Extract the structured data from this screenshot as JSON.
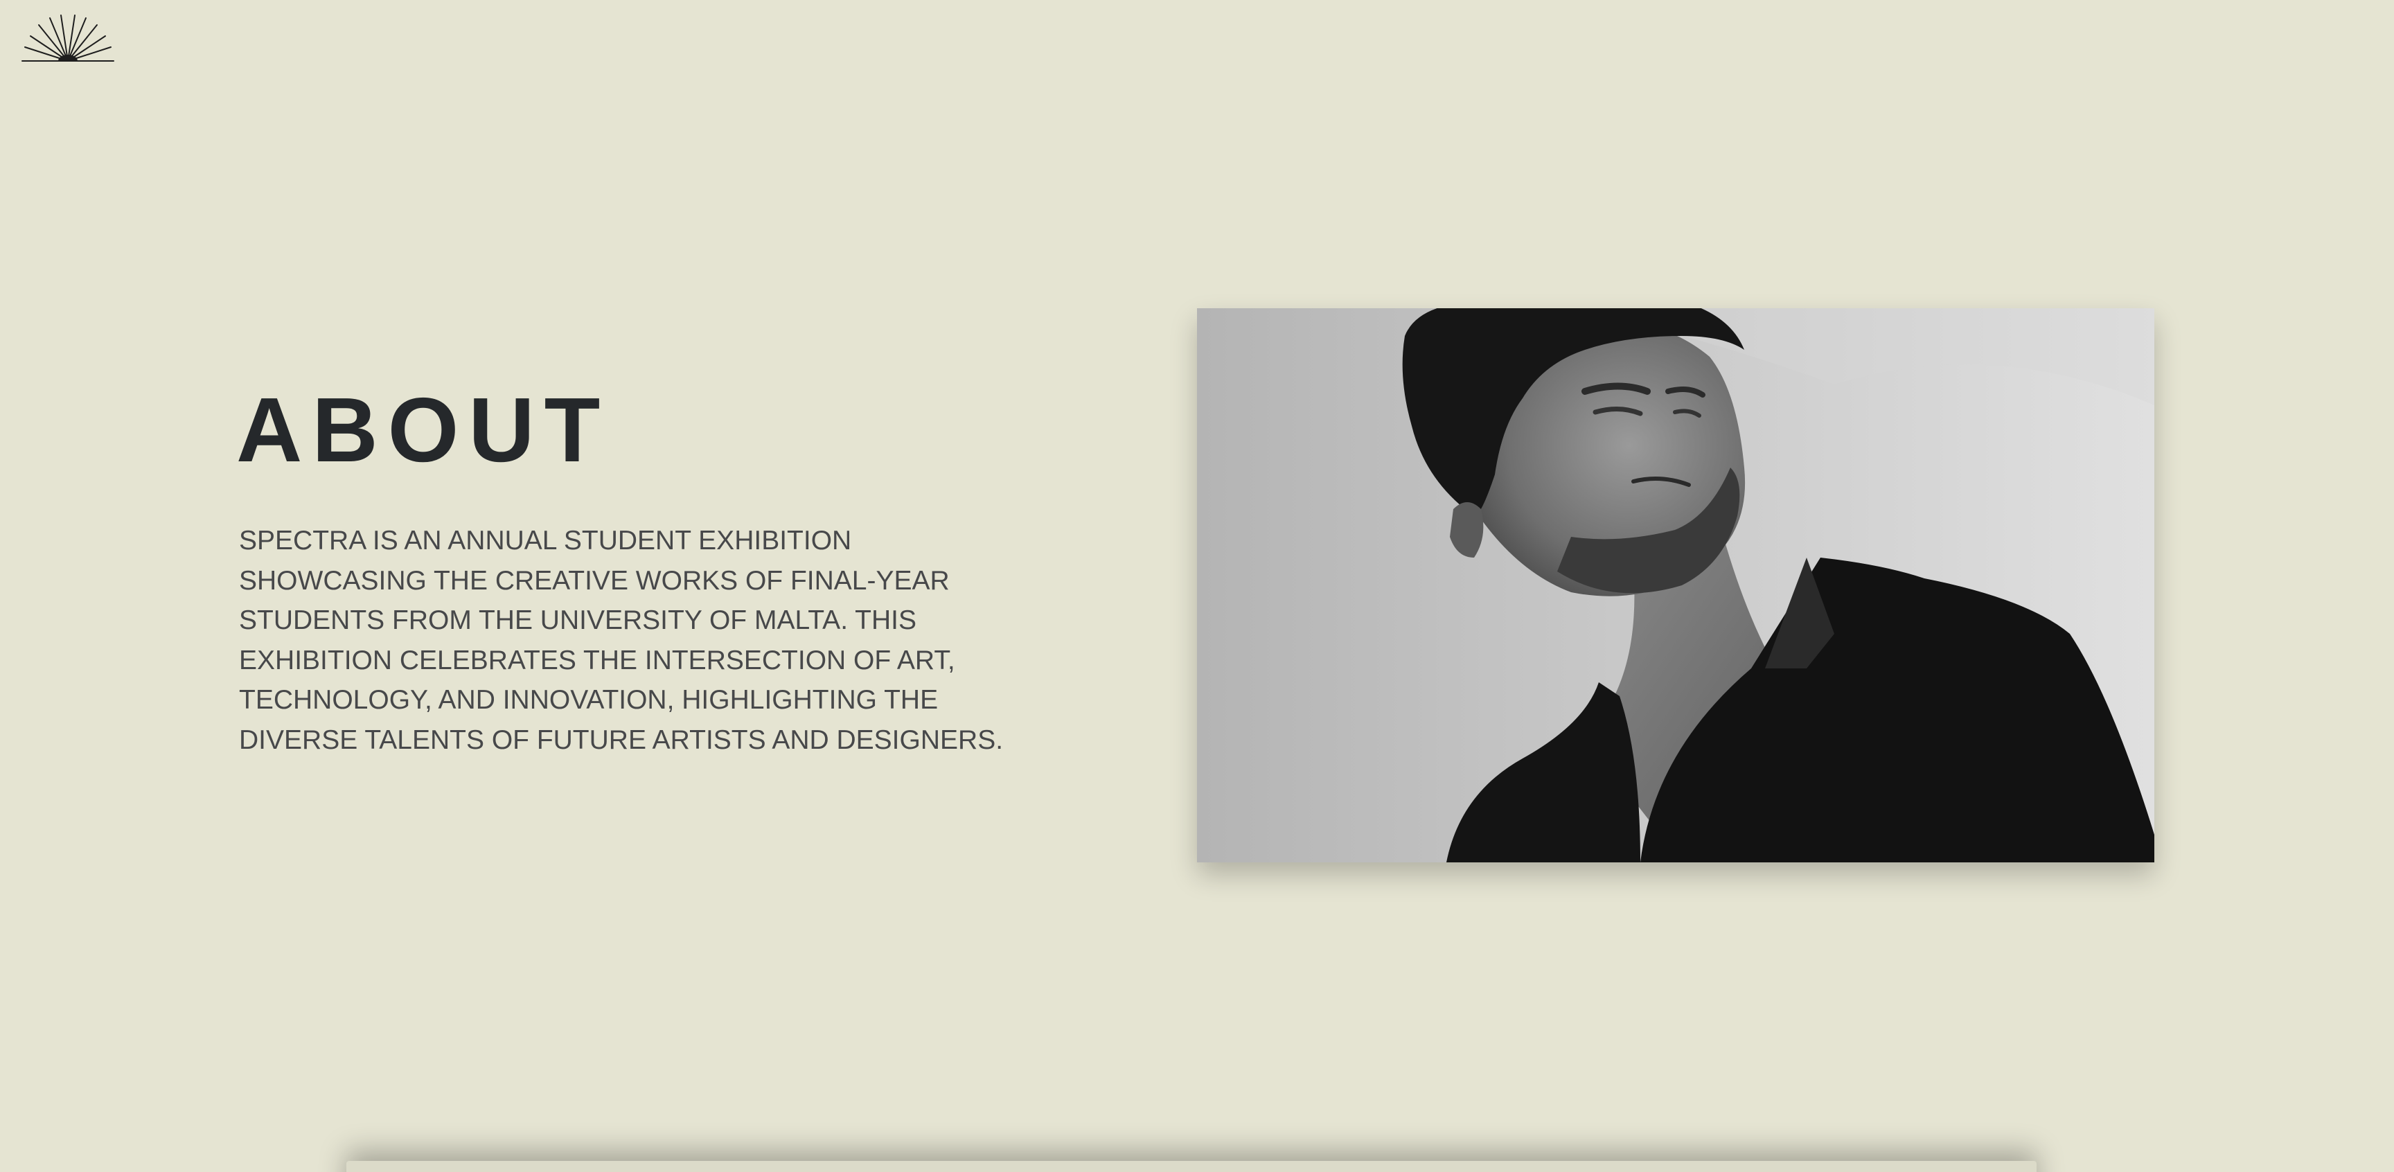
{
  "colors": {
    "background": "#e5e4d2",
    "heading": "#25282b",
    "body_text": "#47484a"
  },
  "header": {
    "logo_icon": "sunburst-logo-icon"
  },
  "about": {
    "title": "ABOUT",
    "description": "SPECTRA IS AN ANNUAL STUDENT EXHIBITION\nSHOWCASING THE CREATIVE WORKS OF FINAL-YEAR\nSTUDENTS FROM THE UNIVERSITY OF MALTA. THIS\nEXHIBITION CELEBRATES THE INTERSECTION OF ART,\nTECHNOLOGY, AND INNOVATION, HIGHLIGHTING THE\nDIVERSE TALENTS OF FUTURE ARTISTS AND DESIGNERS."
  },
  "hero_image": {
    "subject": "black-and-white portrait photo"
  }
}
